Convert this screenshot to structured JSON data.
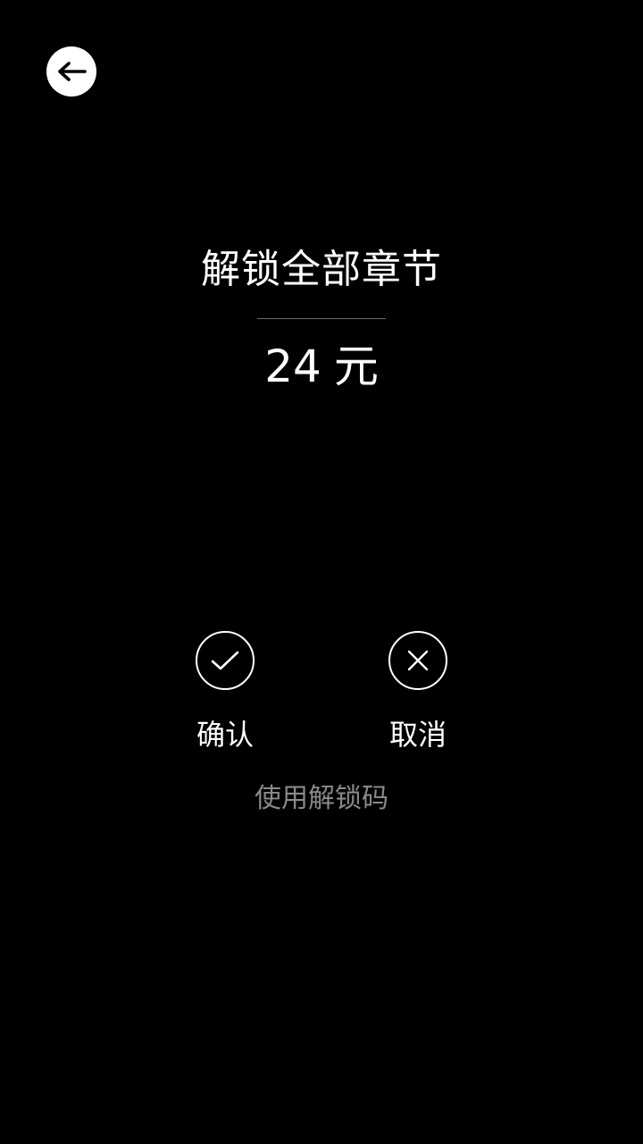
{
  "header": {
    "back_icon": "arrow-left-icon"
  },
  "purchase": {
    "title": "解锁全部章节",
    "price_amount": "24",
    "price_unit": "元"
  },
  "actions": {
    "confirm_label": "确认",
    "confirm_icon": "check-circle-icon",
    "cancel_label": "取消",
    "cancel_icon": "close-circle-icon"
  },
  "unlock_code_link": "使用解锁码",
  "colors": {
    "background": "#000000",
    "text_primary": "#ffffff",
    "text_secondary": "#8a8a8a",
    "divider": "#6a6a6a"
  }
}
